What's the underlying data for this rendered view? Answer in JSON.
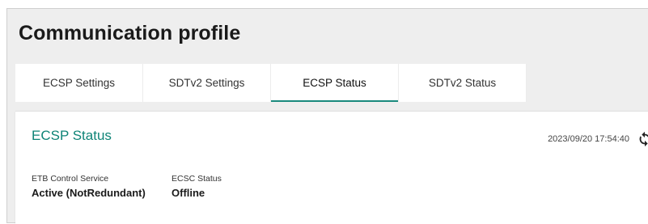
{
  "page": {
    "title": "Communication profile"
  },
  "tabs": [
    {
      "label": "ECSP Settings",
      "active": false
    },
    {
      "label": "SDTv2 Settings",
      "active": false
    },
    {
      "label": "ECSP Status",
      "active": true
    },
    {
      "label": "SDTv2 Status",
      "active": false
    }
  ],
  "card": {
    "title": "ECSP Status",
    "timestamp": "2023/09/20 17:54:40",
    "refresh_icon": "refresh-icon",
    "fields": [
      {
        "label": "ETB Control Service",
        "value": "Active (NotRedundant)"
      },
      {
        "label": "ECSC Status",
        "value": "Offline"
      }
    ]
  },
  "colors": {
    "accent": "#1a8a7d",
    "title_teal": "#0f8477",
    "background": "#eeeeee"
  }
}
